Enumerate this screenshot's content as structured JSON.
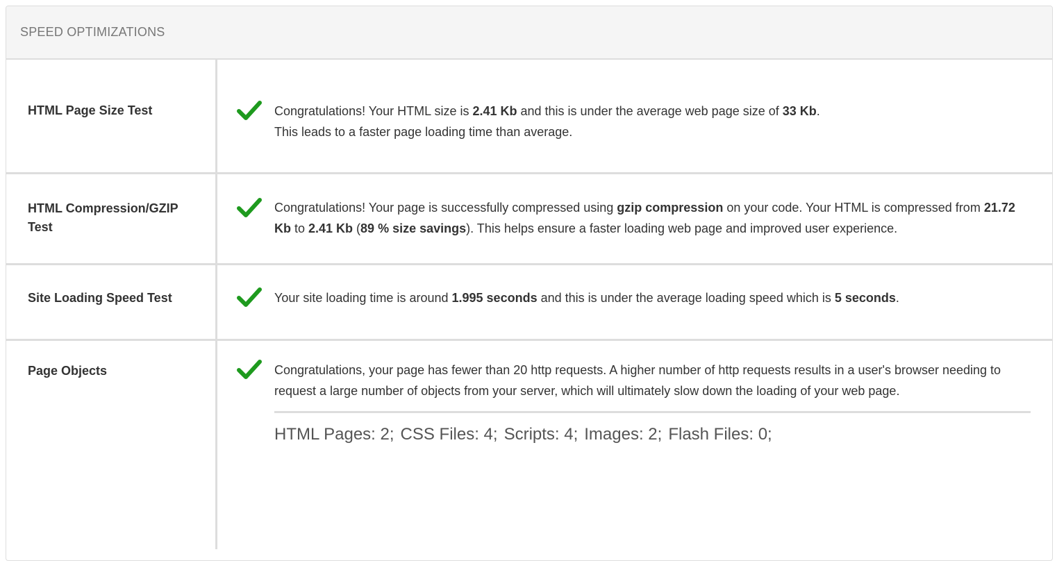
{
  "panel": {
    "title": "SPEED OPTIMIZATIONS"
  },
  "colors": {
    "check": "#1e9a1e",
    "border": "#dddddd",
    "heading_bg": "#f5f5f5"
  },
  "rows": [
    {
      "label": "HTML Page Size Test",
      "icon": "check-icon",
      "line1_a": "Congratulations! Your HTML size is ",
      "line1_b": "2.41 Kb",
      "line1_c": " and this is under the average web page size of ",
      "line1_d": "33 Kb",
      "line1_e": ".",
      "line2": "This leads to a faster page loading time than average."
    },
    {
      "label": "HTML Compression/GZIP Test",
      "icon": "check-icon",
      "p_a": "Congratulations! Your page is successfully compressed using ",
      "p_b": "gzip compression",
      "p_c": " on your code. Your HTML is compressed from ",
      "p_d": "21.72 Kb",
      "p_e": " to ",
      "p_f": "2.41 Kb",
      "p_g": " (",
      "p_h": "89 % size savings",
      "p_i": "). This helps ensure a faster loading web page and improved user experience."
    },
    {
      "label": "Site Loading Speed Test",
      "icon": "check-icon",
      "p_a": "Your site loading time is around ",
      "p_b": "1.995 seconds",
      "p_c": " and this is under the average loading speed which is ",
      "p_d": "5 seconds",
      "p_e": "."
    },
    {
      "label": "Page Objects",
      "icon": "check-icon",
      "text": "Congratulations, your page has fewer than 20 http requests. A higher number of http requests results in a user's browser needing to request a large number of objects from your server, which will ultimately slow down the loading of your web page.",
      "objects": [
        "HTML Pages: 2;",
        "CSS Files: 4;",
        "Scripts: 4;",
        "Images: 2;",
        "Flash Files: 0;"
      ]
    }
  ]
}
